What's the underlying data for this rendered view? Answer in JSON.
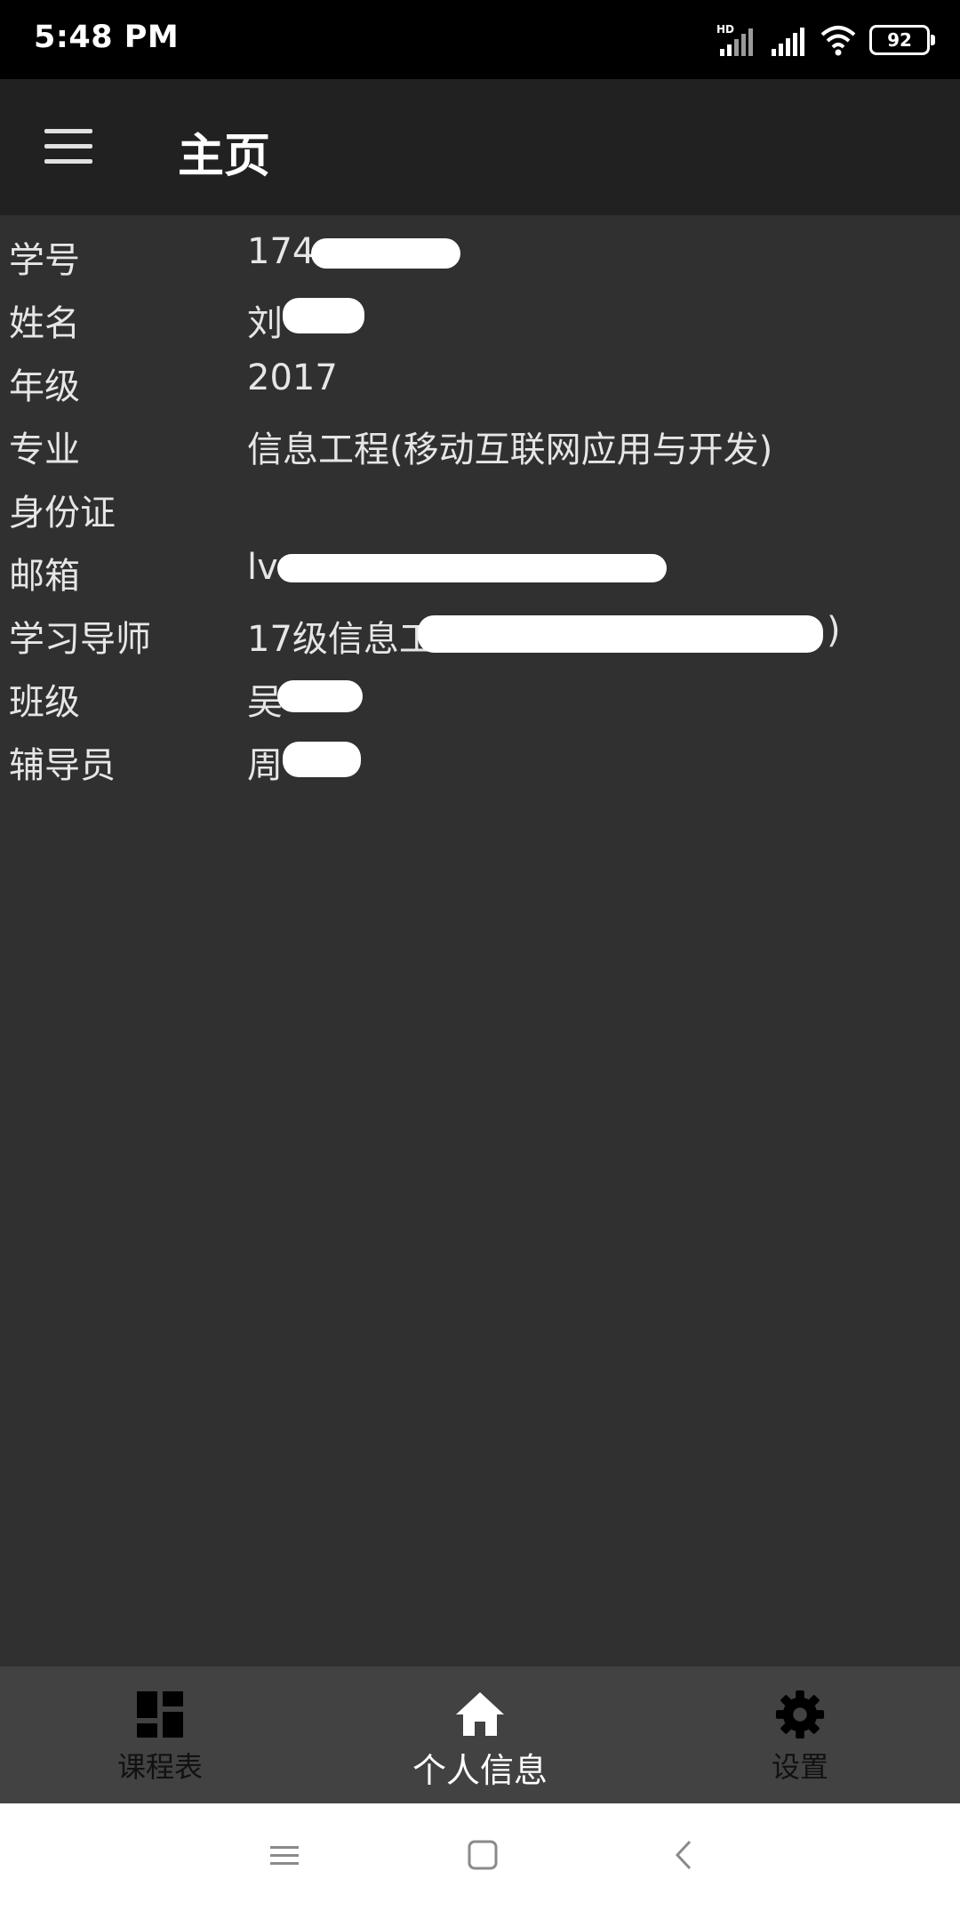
{
  "status_bar": {
    "time": "5:48 PM",
    "hd_label": "HD",
    "battery": "92"
  },
  "app_bar": {
    "title": "主页"
  },
  "info_rows": [
    {
      "label": "学号",
      "value": "174"
    },
    {
      "label": "姓名",
      "value": "刘"
    },
    {
      "label": "年级",
      "value": "2017"
    },
    {
      "label": "专业",
      "value": "信息工程(移动互联网应用与开发)"
    },
    {
      "label": "身份证",
      "value": ""
    },
    {
      "label": "邮箱",
      "value": "lv"
    },
    {
      "label": "学习导师",
      "value": "17级信息工"
    },
    {
      "label": "班级",
      "value": "吴"
    },
    {
      "label": "辅导员",
      "value": "周"
    }
  ],
  "tutor_suffix": ")",
  "bottom_nav": {
    "items": [
      {
        "label": "课程表",
        "icon": "dashboard-icon",
        "active": false
      },
      {
        "label": "个人信息",
        "icon": "home-icon",
        "active": true
      },
      {
        "label": "设置",
        "icon": "gear-icon",
        "active": false
      }
    ]
  },
  "system_nav": {
    "icons": [
      "recents-icon",
      "home-square-icon",
      "back-icon"
    ]
  },
  "colors": {
    "status_bar": "#000000",
    "app_bar": "#212121",
    "background": "#303030",
    "bottom_nav": "#424242",
    "text": "#e6e6e6"
  }
}
